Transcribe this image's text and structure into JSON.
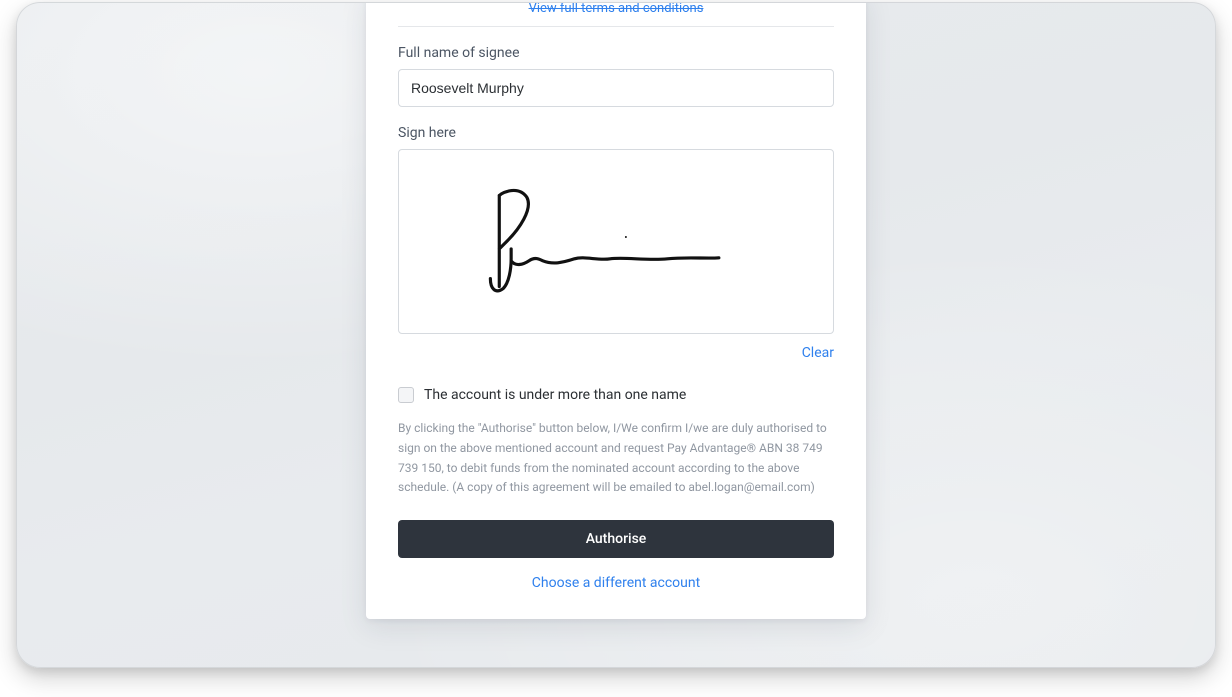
{
  "termsLink": "View full terms and conditions",
  "fullNameLabel": "Full name of signee",
  "fullNameValue": "Roosevelt Murphy",
  "signHereLabel": "Sign here",
  "clearLabel": "Clear",
  "multiAccountLabel": "The account is under more than one name",
  "disclaimer": "By clicking the \"Authorise\" button below, I/We confirm I/we are duly authorised to sign on the above mentioned account and request Pay Advantage® ABN 38 749 739 150, to debit funds from the nominated account according to the above schedule. (A copy of this agreement will be emailed to abel.logan@email.com)",
  "authoriseLabel": "Authorise",
  "chooseDifferentLabel": "Choose a different account"
}
